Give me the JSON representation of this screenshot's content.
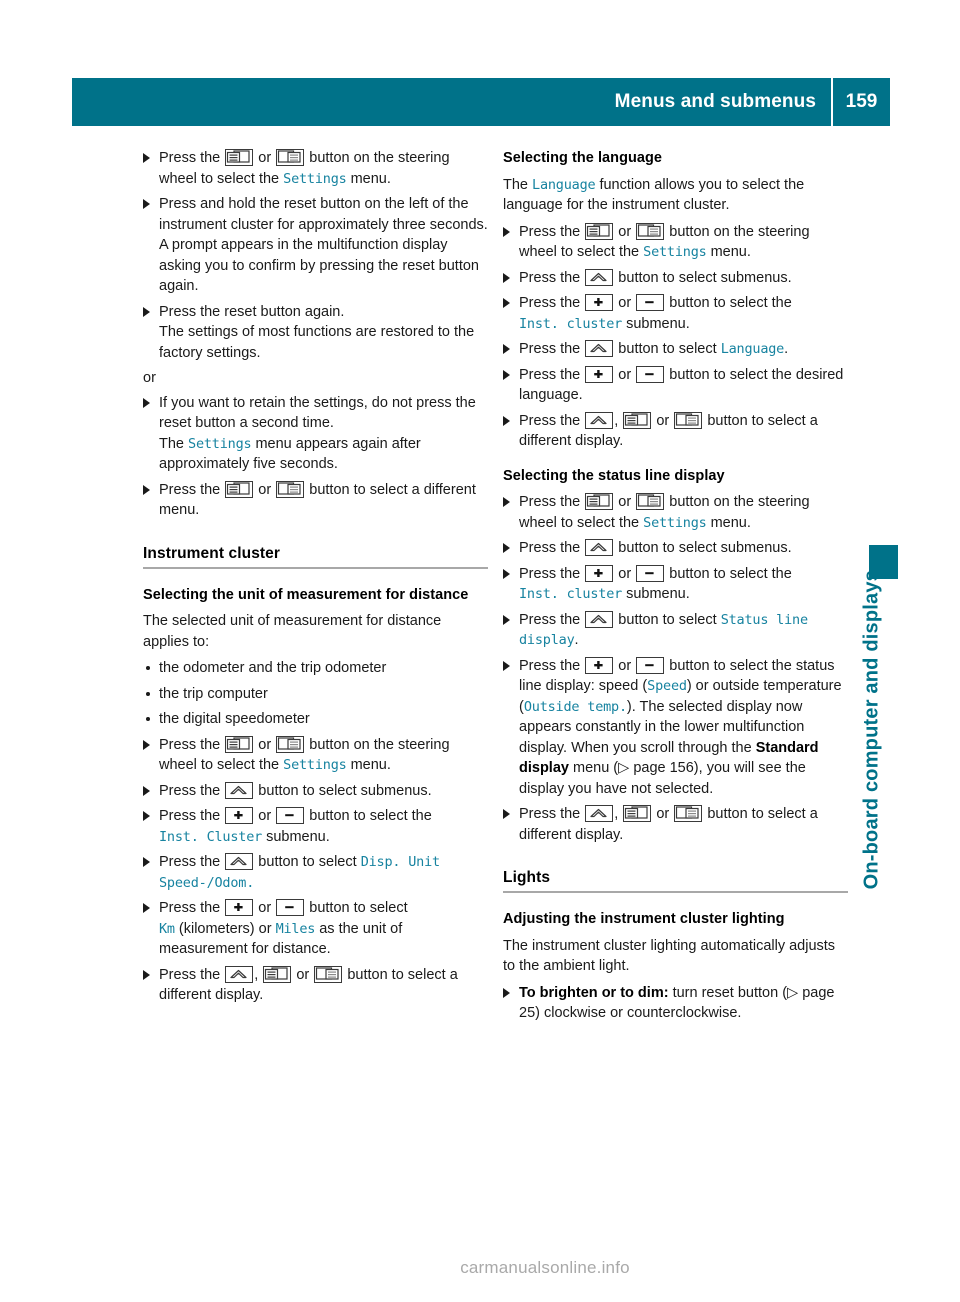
{
  "header": {
    "title": "Menus and submenus",
    "page_number": "159"
  },
  "side_tab": {
    "label": "On-board computer and displays",
    "color": "#007289"
  },
  "watermark": "carmanualsonline.info",
  "icons": {
    "mfd_left": "multifunction-display-left-icon",
    "mfd_right": "multifunction-display-right-icon",
    "up_arrow": "up-arrow-button-icon",
    "plus": "plus-button-icon",
    "minus": "minus-button-icon"
  },
  "left_column": {
    "step1": {
      "a": "Press the ",
      "b": " or ",
      "c": " button on the steering wheel to select the ",
      "menu": "Settings",
      "d": " menu."
    },
    "step2": "Press and hold the reset button on the left of the instrument cluster for approximately three seconds.",
    "step2_cont": "A prompt appears in the multifunction display asking you to confirm by pressing the reset button again.",
    "step3": "Press the reset button again.",
    "step3_cont": "The settings of most functions are restored to the factory settings.",
    "or": "or",
    "step4": "If you want to retain the settings, do not press the reset button a second time.",
    "step4_cont_a": "The ",
    "step4_menu": "Settings",
    "step4_cont_b": " menu appears again after approximately five seconds.",
    "step5": {
      "a": "Press the ",
      "b": " or ",
      "c": " button to select a different menu."
    },
    "section_heading": "Instrument cluster",
    "subheading": "Selecting the unit of measurement for distance",
    "intro": "The selected unit of measurement for distance applies to:",
    "bullets": [
      "the odometer and the trip odometer",
      "the trip computer",
      "the digital speedometer"
    ],
    "step6": {
      "a": "Press the ",
      "b": " or ",
      "c": " button on the steering wheel to select the ",
      "menu": "Settings",
      "d": " menu."
    },
    "step7": {
      "a": "Press the ",
      "b": " button to select submenus."
    },
    "step8": {
      "a": "Press the ",
      "b": " or ",
      "c": " button to select the ",
      "menu": "Inst. Cluster",
      "d": " submenu."
    },
    "step9": {
      "a": "Press the ",
      "b": " button to select ",
      "menu": "Disp. Unit Speed-/Odom."
    },
    "step10": {
      "a": "Press the ",
      "b": " or ",
      "c": " button to select ",
      "km": "Km",
      "d": " (kilometers) or ",
      "miles": "Miles",
      "e": " as the unit of measurement for distance."
    },
    "step11": {
      "a": "Press the ",
      "b": ", ",
      "c": " or ",
      "d": " button to select a different display."
    }
  },
  "right_column": {
    "lang_heading": "Selecting the language",
    "lang_intro_a": "The ",
    "lang_intro_menu": "Language",
    "lang_intro_b": " function allows you to select the language for the instrument cluster.",
    "step1": {
      "a": "Press the ",
      "b": " or ",
      "c": " button on the steering wheel to select the ",
      "menu": "Settings",
      "d": " menu."
    },
    "step2": {
      "a": "Press the ",
      "b": " button to select submenus."
    },
    "step3": {
      "a": "Press the ",
      "b": " or ",
      "c": " button to select the ",
      "menu": "Inst. cluster",
      "d": " submenu."
    },
    "step4": {
      "a": "Press the ",
      "b": " button to select ",
      "menu": "Language",
      "c": "."
    },
    "step5": {
      "a": "Press the ",
      "b": " or ",
      "c": " button to select the desired language."
    },
    "step6": {
      "a": "Press the ",
      "b": ", ",
      "c": " or ",
      "d": " button to select a different display."
    },
    "status_heading": "Selecting the status line display",
    "step7": {
      "a": "Press the ",
      "b": " or ",
      "c": " button on the steering wheel to select the ",
      "menu": "Settings",
      "d": " menu."
    },
    "step8": {
      "a": "Press the ",
      "b": " button to select submenus."
    },
    "step9": {
      "a": "Press the ",
      "b": " or ",
      "c": " button to select the ",
      "menu": "Inst. cluster",
      "d": " submenu."
    },
    "step10": {
      "a": "Press the ",
      "b": " button to select ",
      "menu": "Status line display",
      "c": "."
    },
    "step11": {
      "a": "Press the ",
      "b": " or ",
      "c": " button to select the status line display: speed (",
      "speed": "Speed",
      "d": ") or outside temperature (",
      "temp": "Outside temp.",
      "e": "). The selected display now appears constantly in the lower multifunction display. When you scroll through the ",
      "std": "Standard display",
      "f": " menu (",
      "ref": " page 156), you will see the display you have not selected."
    },
    "step12": {
      "a": "Press the ",
      "b": ", ",
      "c": " or ",
      "d": " button to select a different display."
    },
    "lights_heading": "Lights",
    "lights_sub": "Adjusting the instrument cluster lighting",
    "lights_para": "The instrument cluster lighting automatically adjusts to the ambient light.",
    "lights_step_bold": "To brighten or to dim:",
    "lights_step_a": " turn reset button (",
    "lights_step_ref": " page 25",
    "lights_step_b": ") clockwise or counterclockwise."
  }
}
